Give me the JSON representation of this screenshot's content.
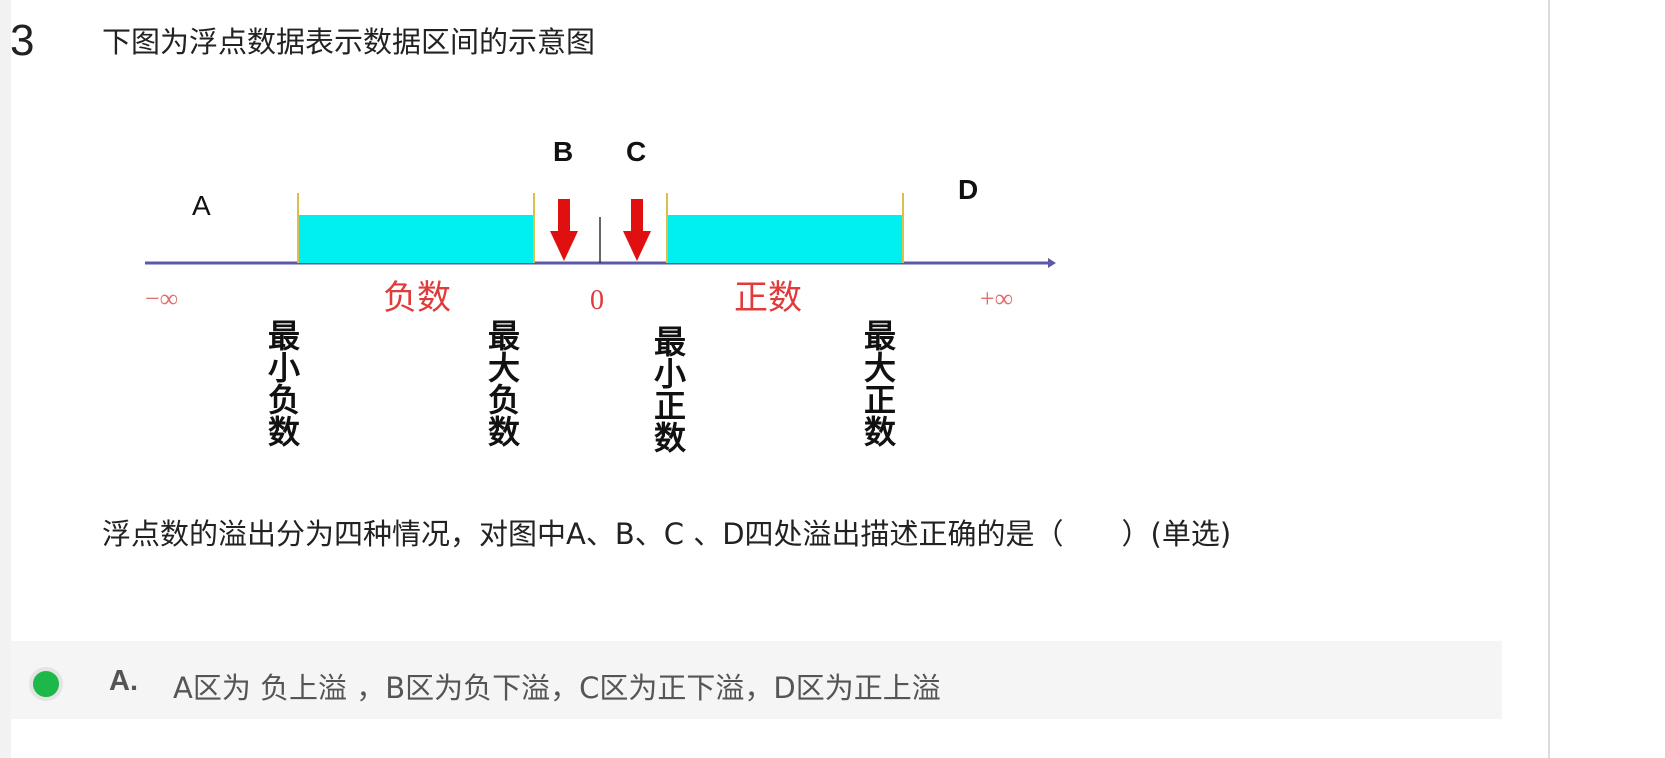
{
  "question": {
    "number": "3",
    "title": "下图为浮点数据表示数据区间的示意图",
    "body": "浮点数的溢出分为四种情况，对图中A、B、C 、D四处溢出描述正确的是（　　）(单选)"
  },
  "figure": {
    "labels": {
      "a": "A",
      "b": "B",
      "c": "C",
      "d": "D"
    },
    "neg_inf": "−∞",
    "pos_inf": "+∞",
    "zero": "0",
    "negative": "负数",
    "positive": "正数",
    "min_negative": "最小负数",
    "max_negative": "最大负数",
    "min_positive": "最小正数",
    "max_positive": "最大正数",
    "colors": {
      "bar": "#00f0f0",
      "arrow": "#e01010",
      "axis": "#5a5aa8",
      "tick": "#d9c04a",
      "accent_text": "#e03a3a"
    }
  },
  "options": [
    {
      "key": "A.",
      "text": "A区为 负上溢 ，B区为负下溢，C区为正下溢，D区为正上溢",
      "selected": true
    }
  ]
}
